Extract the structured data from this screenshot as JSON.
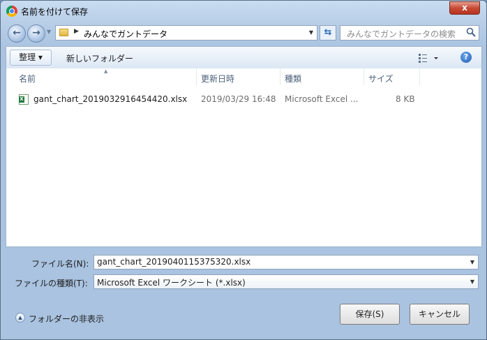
{
  "window": {
    "title": "名前を付けて保存",
    "close_label": "x"
  },
  "address_bar": {
    "path": "みんなでガントデータ"
  },
  "search": {
    "placeholder": "みんなでガントデータの検索"
  },
  "toolbar": {
    "organize_label": "整理 ▾",
    "new_folder_label": "新しいフォルダー"
  },
  "file_list": {
    "columns": [
      "名前",
      "更新日時",
      "種類",
      "サイズ"
    ],
    "rows": [
      {
        "name": "gant_chart_2019032916454420.xlsx",
        "modified": "2019/03/29 16:48",
        "type": "Microsoft Excel ...",
        "size": "8 KB"
      }
    ]
  },
  "form": {
    "filename_label": "ファイル名(N):",
    "filename_value": "gant_chart_2019040115375320.xlsx",
    "filetype_label": "ファイルの種類(T):",
    "filetype_value": "Microsoft Excel ワークシート (*.xlsx)"
  },
  "footer": {
    "hide_folders_label": "フォルダーの非表示",
    "save_label": "保存(S)",
    "cancel_label": "キャンセル"
  },
  "colors": {
    "accent": "#2a6bb8",
    "close": "#c74a35"
  },
  "icons": [
    "chrome-icon",
    "back-arrow-icon",
    "forward-arrow-icon",
    "folder-icon",
    "refresh-icon",
    "search-icon",
    "view-icon",
    "help-icon",
    "excel-file-icon",
    "chevron-up-icon"
  ]
}
